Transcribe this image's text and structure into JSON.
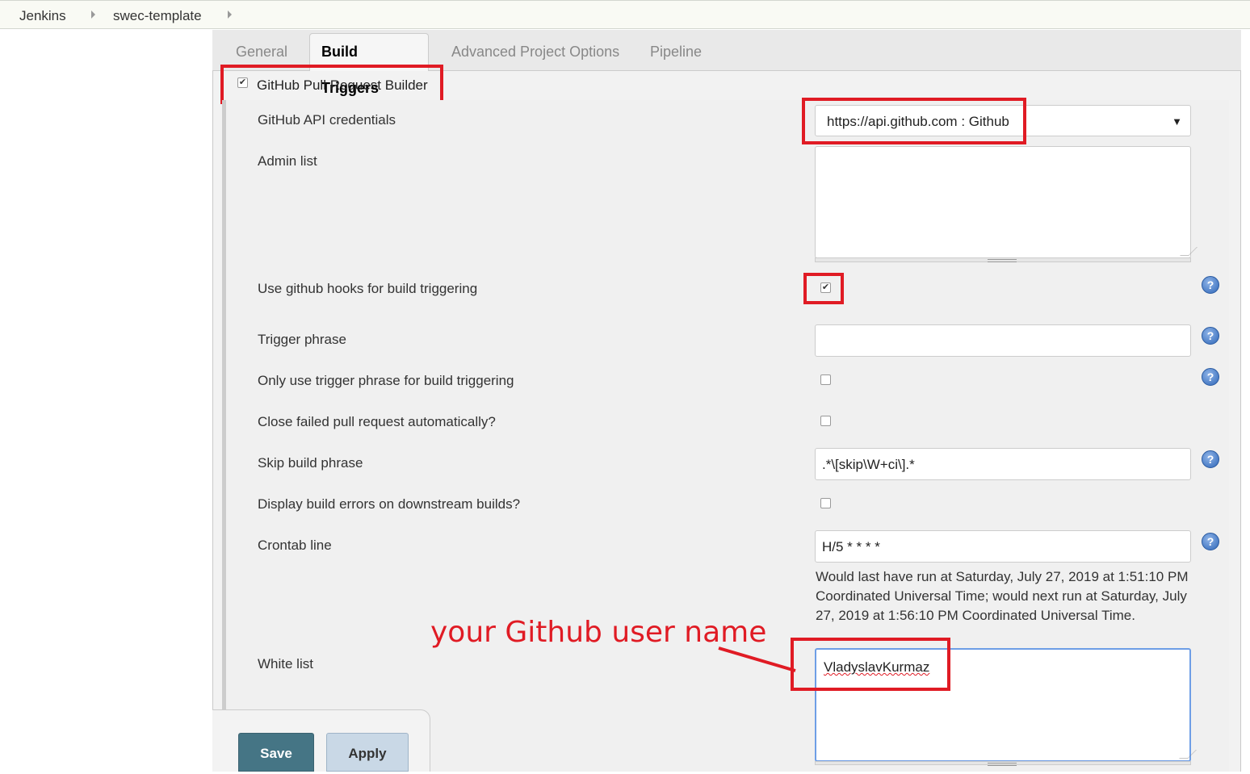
{
  "breadcrumb": {
    "items": [
      "Jenkins",
      "swec-template"
    ]
  },
  "tabs": [
    "General",
    "Build Triggers",
    "Advanced Project Options",
    "Pipeline"
  ],
  "active_tab": "Build Triggers",
  "trigger": {
    "label": "GitHub Pull Request Builder",
    "checked": true
  },
  "form": {
    "credentials_label": "GitHub API credentials",
    "credentials_value": "https://api.github.com : Github",
    "admin_list_label": "Admin list",
    "admin_list_value": "",
    "use_hooks_label": "Use github hooks for build triggering",
    "use_hooks_checked": true,
    "trigger_phrase_label": "Trigger phrase",
    "trigger_phrase_value": "",
    "only_trigger_label": "Only use trigger phrase for build triggering",
    "only_trigger_checked": false,
    "close_failed_label": "Close failed pull request automatically?",
    "close_failed_checked": false,
    "skip_phrase_label": "Skip build phrase",
    "skip_phrase_value": ".*\\[skip\\W+ci\\].*",
    "display_errors_label": "Display build errors on downstream builds?",
    "display_errors_checked": false,
    "crontab_label": "Crontab line",
    "crontab_value": "H/5 * * * *",
    "crontab_note": "Would last have run at Saturday, July 27, 2019 at 1:51:10 PM Coordinated Universal Time; would next run at Saturday, July 27, 2019 at 1:56:10 PM Coordinated Universal Time.",
    "white_list_label": "White list",
    "white_list_value": "VladyslavKurmaz"
  },
  "annotation": {
    "text": "your Github user name",
    "color": "#e01b24"
  },
  "buttons": {
    "save": "Save",
    "apply": "Apply"
  },
  "icons": {
    "help": "help-icon",
    "dropdown": "dropdown-arrow-icon"
  },
  "help_glyph": "?",
  "colors": {
    "save_bg": "#457585",
    "apply_bg": "#c9d8e6",
    "highlight": "#e01b24"
  }
}
